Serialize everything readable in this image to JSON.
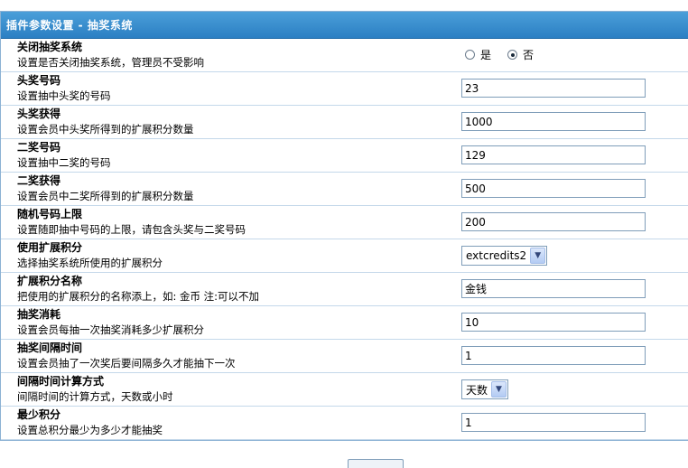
{
  "panel": {
    "title": "插件参数设置 - 抽奖系统"
  },
  "settings": [
    {
      "label": "关闭抽奖系统",
      "desc": "设置是否关闭抽奖系统，管理员不受影响",
      "type": "radio",
      "options": [
        {
          "label": "是",
          "checked": false
        },
        {
          "label": "否",
          "checked": true
        }
      ]
    },
    {
      "label": "头奖号码",
      "desc": "设置抽中头奖的号码",
      "type": "text",
      "value": "23"
    },
    {
      "label": "头奖获得",
      "desc": "设置会员中头奖所得到的扩展积分数量",
      "type": "text",
      "value": "1000"
    },
    {
      "label": "二奖号码",
      "desc": "设置抽中二奖的号码",
      "type": "text",
      "value": "129"
    },
    {
      "label": "二奖获得",
      "desc": "设置会员中二奖所得到的扩展积分数量",
      "type": "text",
      "value": "500"
    },
    {
      "label": "随机号码上限",
      "desc": "设置随即抽中号码的上限，请包含头奖与二奖号码",
      "type": "text",
      "value": "200"
    },
    {
      "label": "使用扩展积分",
      "desc": "选择抽奖系统所使用的扩展积分",
      "type": "select",
      "value": "extcredits2"
    },
    {
      "label": "扩展积分名称",
      "desc": "把使用的扩展积分的名称添上，如: 金币 注:可以不加",
      "type": "text",
      "value": "金钱"
    },
    {
      "label": "抽奖消耗",
      "desc": "设置会员每抽一次抽奖消耗多少扩展积分",
      "type": "text",
      "value": "10"
    },
    {
      "label": "抽奖间隔时间",
      "desc": "设置会员抽了一次奖后要间隔多久才能抽下一次",
      "type": "text",
      "value": "1"
    },
    {
      "label": "间隔时间计算方式",
      "desc": "间隔时间的计算方式，天数或小时",
      "type": "select",
      "value": "天数"
    },
    {
      "label": "最少积分",
      "desc": "设置总积分最少为多少才能抽奖",
      "type": "text",
      "value": "1"
    }
  ]
}
